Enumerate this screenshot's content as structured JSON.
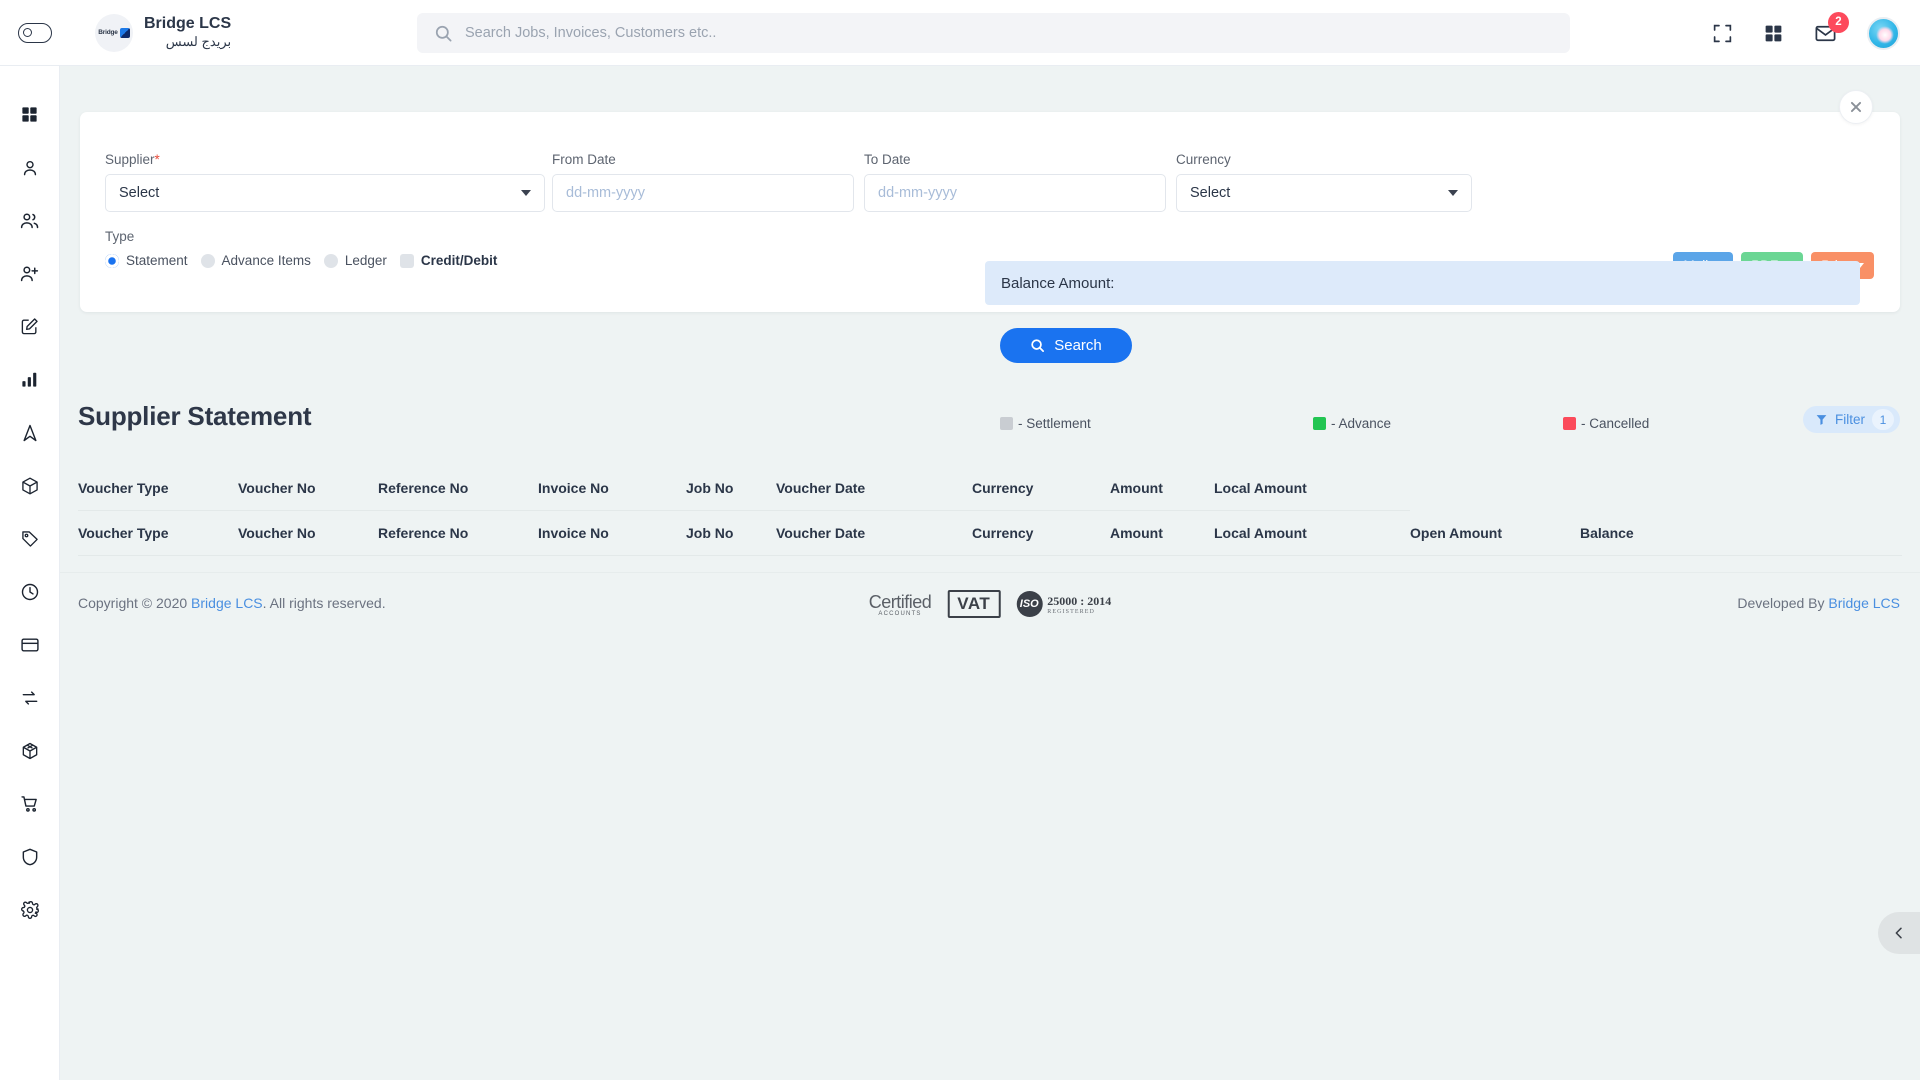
{
  "topbar": {
    "brand_name": "Bridge LCS",
    "brand_name_ar": "بريدج لسس",
    "logo_text": "Bridge",
    "search_placeholder": "Search Jobs, Invoices, Customers etc..",
    "search_value": "",
    "mail_badge": "2"
  },
  "sidebar": {
    "items": [
      {
        "icon": "dashboard-grid-icon",
        "name": "sidebar-item-dashboard"
      },
      {
        "icon": "user-icon",
        "name": "sidebar-item-user"
      },
      {
        "icon": "users-icon",
        "name": "sidebar-item-users"
      },
      {
        "icon": "user-add-icon",
        "name": "sidebar-item-add-user"
      },
      {
        "icon": "edit-square-icon",
        "name": "sidebar-item-edit"
      },
      {
        "icon": "bar-chart-icon",
        "name": "sidebar-item-reports"
      },
      {
        "icon": "navigation-arrow-icon",
        "name": "sidebar-item-tracking"
      },
      {
        "icon": "package-box-icon",
        "name": "sidebar-item-packages"
      },
      {
        "icon": "tag-icon",
        "name": "sidebar-item-pricing"
      },
      {
        "icon": "clock-icon",
        "name": "sidebar-item-history"
      },
      {
        "icon": "credit-card-icon",
        "name": "sidebar-item-payments"
      },
      {
        "icon": "refresh-arrows-icon",
        "name": "sidebar-item-transactions"
      },
      {
        "icon": "gift-box-icon",
        "name": "sidebar-item-inventory"
      },
      {
        "icon": "shopping-cart-icon",
        "name": "sidebar-item-purchases"
      },
      {
        "icon": "shield-icon",
        "name": "sidebar-item-security"
      },
      {
        "icon": "gear-icon",
        "name": "sidebar-item-settings"
      }
    ]
  },
  "filter_panel": {
    "supplier_label": "Supplier",
    "supplier_required_mark": "*",
    "supplier_value": "Select",
    "from_date_label": "From Date",
    "from_date_placeholder": "dd-mm-yyyy",
    "from_date_value": "",
    "to_date_label": "To Date",
    "to_date_placeholder": "dd-mm-yyyy",
    "to_date_value": "",
    "currency_label": "Currency",
    "currency_value": "Select",
    "type_label": "Type",
    "type_options": [
      {
        "label": "Statement",
        "control": "radio",
        "selected": true
      },
      {
        "label": "Advance Items",
        "control": "radio",
        "selected": false
      },
      {
        "label": "Ledger",
        "control": "radio",
        "selected": false
      },
      {
        "label": "Credit/Debit",
        "control": "checkbox",
        "selected": false
      }
    ],
    "balance_label": "Balance Amount:",
    "balance_value": "",
    "search_button": "Search",
    "actions": [
      {
        "label": "Mail",
        "color": "#5ba5e8",
        "name": "mail-button"
      },
      {
        "label": "PDF",
        "color": "#6bd694",
        "name": "pdf-button"
      },
      {
        "label": "Print",
        "color": "#f99066",
        "name": "print-button"
      }
    ]
  },
  "report": {
    "title": "Supplier Statement",
    "legend": [
      {
        "label": "- Settlement",
        "color": "#c9cdd2"
      },
      {
        "label": "- Advance",
        "color": "#22c552"
      },
      {
        "label": "- Cancelled",
        "color": "#fb4a5a"
      }
    ],
    "filter_button": "Filter",
    "filter_count": "1",
    "header_row_1": [
      "Voucher Type",
      "Voucher No",
      "Reference No",
      "Invoice No",
      "Job No",
      "Voucher Date",
      "Currency",
      "Amount",
      "Local Amount"
    ],
    "header_row_2": [
      "Voucher Type",
      "Voucher No",
      "Reference No",
      "Invoice No",
      "Job No",
      "Voucher Date",
      "Currency",
      "Amount",
      "Local Amount",
      "Open Amount",
      "Balance"
    ],
    "rows": []
  },
  "footer": {
    "copyright_prefix": "Copyright © 2020 ",
    "copyright_link": "Bridge LCS",
    "copyright_suffix": ". All rights reserved.",
    "developed_prefix": "Developed By ",
    "developed_link": "Bridge LCS",
    "logos": {
      "certified_1": "Certified",
      "certified_2": "ACCOUNTS",
      "vat": "VAT",
      "iso_mark": "ISO",
      "iso_standard": "25000 : 2014",
      "iso_sub": "REGISTERED"
    }
  }
}
